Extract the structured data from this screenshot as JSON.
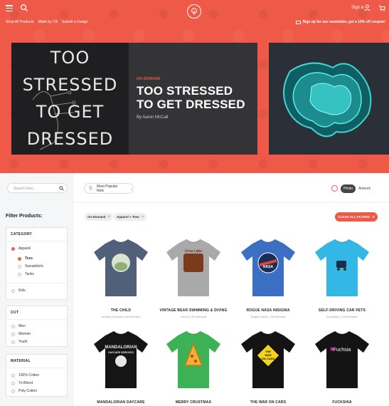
{
  "header": {
    "signin_label": "Sign in",
    "subnav": [
      "Shop All Products",
      "Made by CB",
      "Submit a Design"
    ],
    "newsletter": "Sign up for our newsletter, get a 10% off coupon!",
    "colors": {
      "accent": "#ee5a47"
    }
  },
  "hero": {
    "tag": "ON-DEMAND",
    "title": "TOO STRESSED TO GET DRESSED",
    "author": "By Aaron McCall",
    "art_lines": [
      "TOO",
      "STRESSED",
      "TO GET",
      "DRESSED"
    ]
  },
  "sidebar": {
    "search_placeholder": "Search here...",
    "filter_title": "Filter Products:",
    "category": {
      "heading": "CATEGORY",
      "apparel": "Apparel",
      "tees": "Tees",
      "sweatshirts": "Sweatshirts",
      "tanks": "Tanks",
      "kids": "Kids"
    },
    "cut": {
      "heading": "CUT",
      "men": "Men",
      "women": "Women",
      "youth": "Youth"
    },
    "material": {
      "heading": "MATERIAL",
      "cotton": "100% Cotton",
      "triblend": "Tri-Blend",
      "polycotton": "Poly-Cotton"
    }
  },
  "toolbar": {
    "sort_label": "Most Popular Now",
    "view_photo": "Photo",
    "view_artwork": "Artwork"
  },
  "filters": {
    "chip1": "On-Demand",
    "chip2": "Apparel > Tees",
    "clear_label": "CLEAR ALL FILTERS"
  },
  "products": [
    {
      "name": "THE CHILD",
      "artist": "Andrew Onowski",
      "type": "On-Demand",
      "shirt_color": "#4f6078",
      "design_color": "#d8e3d0"
    },
    {
      "name": "VINTAGE BEAR SWIMMING & DIVING",
      "artist": "Lefoot",
      "type": "On-Demand",
      "shirt_color": "#a9a9a9",
      "design_color": "#7a3a1c"
    },
    {
      "name": "ROGUE NASA INSIGNIA",
      "artist": "Rogue NASA",
      "type": "On-Demand",
      "shirt_color": "#3a6fc4",
      "design_color": "#e04a2c"
    },
    {
      "name": "SELF-DRIVING CAR PETS",
      "artist": "Donalhmir",
      "type": "On-Demand",
      "shirt_color": "#33b8e6",
      "design_color": "#333333"
    },
    {
      "name": "MANDALORIAN DAYCARE",
      "artist": "",
      "type": "",
      "shirt_color": "#151515",
      "design_color": "#e6e6e6"
    },
    {
      "name": "MERRY CRUSTMAS",
      "artist": "",
      "type": "",
      "shirt_color": "#3cb155",
      "design_color": "#f0b030"
    },
    {
      "name": "THE WAR ON CARS",
      "artist": "",
      "type": "",
      "shirt_color": "#141414",
      "design_color": "#f5d31a"
    },
    {
      "name": "FUCKSHIA",
      "artist": "",
      "type": "",
      "shirt_color": "#141414",
      "design_color": "#e0208a"
    }
  ],
  "product_design_text": {
    "p2": "Ursa Lake",
    "p3": "NASA",
    "p5": "MANDALORIAN",
    "p5b": "DAYCARE SERVICES",
    "p7": "THE WAR ON CARS",
    "p8": "Fuchsia"
  }
}
